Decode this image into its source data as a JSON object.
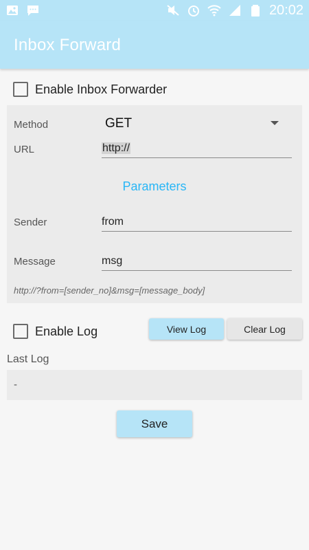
{
  "status_bar": {
    "time": "20:02",
    "left_icons": [
      "gallery-icon",
      "message-icon"
    ],
    "right_icons": [
      "mute-icon",
      "alarm-icon",
      "wifi-icon",
      "signal-icon",
      "battery-icon"
    ]
  },
  "app_bar": {
    "title": "Inbox Forward"
  },
  "forwarder": {
    "enable_label": "Enable Inbox Forwarder",
    "checked": false
  },
  "form": {
    "method_label": "Method",
    "method_value": "GET",
    "url_label": "URL",
    "url_value": "http://",
    "parameters_title": "Parameters",
    "sender_label": "Sender",
    "sender_value": "from",
    "message_label": "Message",
    "message_value": "msg",
    "example_url": "http://?from=[sender_no]&msg=[message_body]"
  },
  "log": {
    "enable_label": "Enable Log",
    "checked": false,
    "view_button": "View Log",
    "clear_button": "Clear Log",
    "last_log_label": "Last Log",
    "last_log_value": "-"
  },
  "save_button": "Save",
  "colors": {
    "accent": "#b6e4f7",
    "link": "#29b6f6",
    "panel": "#ebebeb"
  }
}
